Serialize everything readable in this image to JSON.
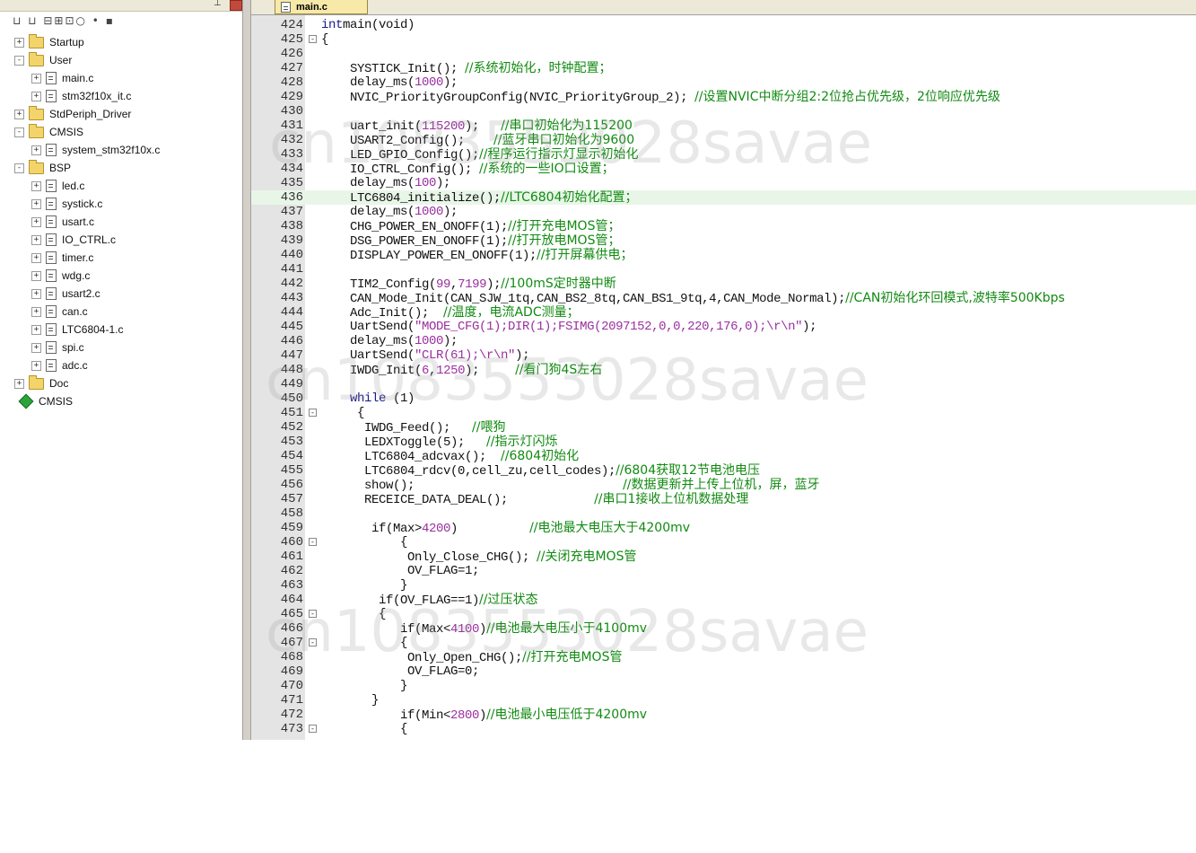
{
  "tab": {
    "label": "main.c"
  },
  "sidebar": {
    "items": [
      {
        "label": "Startup",
        "type": "folder",
        "expander": "+"
      },
      {
        "label": "User",
        "type": "folder",
        "expander": "-"
      },
      {
        "label": "main.c",
        "type": "file",
        "expander": "+"
      },
      {
        "label": "stm32f10x_it.c",
        "type": "file",
        "expander": "+"
      },
      {
        "label": "StdPeriph_Driver",
        "type": "folder",
        "expander": "+"
      },
      {
        "label": "CMSIS",
        "type": "folder",
        "expander": "-"
      },
      {
        "label": "system_stm32f10x.c",
        "type": "file",
        "expander": "+"
      },
      {
        "label": "BSP",
        "type": "folder",
        "expander": "-"
      },
      {
        "label": "led.c",
        "type": "file",
        "expander": "+"
      },
      {
        "label": "systick.c",
        "type": "file",
        "expander": "+"
      },
      {
        "label": "usart.c",
        "type": "file",
        "expander": "+"
      },
      {
        "label": "IO_CTRL.c",
        "type": "file",
        "expander": "+"
      },
      {
        "label": "timer.c",
        "type": "file",
        "expander": "+"
      },
      {
        "label": "wdg.c",
        "type": "file",
        "expander": "+"
      },
      {
        "label": "usart2.c",
        "type": "file",
        "expander": "+"
      },
      {
        "label": "can.c",
        "type": "file",
        "expander": "+"
      },
      {
        "label": "LTC6804-1.c",
        "type": "file",
        "expander": "+"
      },
      {
        "label": "spi.c",
        "type": "file",
        "expander": "+"
      },
      {
        "label": "adc.c",
        "type": "file",
        "expander": "+"
      },
      {
        "label": "Doc",
        "type": "folder",
        "expander": "+"
      },
      {
        "label": "CMSIS",
        "type": "component",
        "expander": ""
      }
    ]
  },
  "code": {
    "lines": [
      {
        "n": "424",
        "fold": "",
        "segs": [
          [
            "kw",
            "int"
          ],
          [
            "",
            "main(void)"
          ]
        ]
      },
      {
        "n": "425",
        "fold": "-",
        "segs": [
          [
            "",
            "{"
          ]
        ]
      },
      {
        "n": "426",
        "fold": "",
        "segs": []
      },
      {
        "n": "427",
        "fold": "",
        "segs": [
          [
            "",
            "    SYSTICK_Init(); "
          ],
          [
            "cm",
            "//系统初始化，时钟配置；"
          ]
        ]
      },
      {
        "n": "428",
        "fold": "",
        "segs": [
          [
            "",
            "    delay_ms("
          ],
          [
            "num",
            "1000"
          ],
          [
            "",
            ");"
          ]
        ]
      },
      {
        "n": "429",
        "fold": "",
        "segs": [
          [
            "",
            "    NVIC_PriorityGroupConfig(NVIC_PriorityGroup_2); "
          ],
          [
            "cm",
            "//设置NVIC中断分组2:2位抢占优先级，2位响应优先级"
          ]
        ]
      },
      {
        "n": "430",
        "fold": "",
        "segs": []
      },
      {
        "n": "431",
        "fold": "",
        "segs": [
          [
            "",
            "    uart_init("
          ],
          [
            "num",
            "115200"
          ],
          [
            "",
            ");   "
          ],
          [
            "cm",
            "//串口初始化为115200"
          ]
        ]
      },
      {
        "n": "432",
        "fold": "",
        "segs": [
          [
            "",
            "    USART2_Config();    "
          ],
          [
            "cm",
            "//蓝牙串口初始化为9600"
          ]
        ]
      },
      {
        "n": "433",
        "fold": "",
        "segs": [
          [
            "",
            "    LED_GPIO_Config();"
          ],
          [
            "cm",
            "//程序运行指示灯显示初始化"
          ]
        ]
      },
      {
        "n": "434",
        "fold": "",
        "segs": [
          [
            "",
            "    IO_CTRL_Config(); "
          ],
          [
            "cm",
            "//系统的一些IO口设置；"
          ]
        ]
      },
      {
        "n": "435",
        "fold": "",
        "segs": [
          [
            "",
            "    delay_ms("
          ],
          [
            "num",
            "100"
          ],
          [
            "",
            ");"
          ]
        ]
      },
      {
        "n": "436",
        "fold": "",
        "hl": true,
        "segs": [
          [
            "",
            "    LTC6804_initialize();"
          ],
          [
            "cm",
            "//LTC6804初始化配置；"
          ]
        ]
      },
      {
        "n": "437",
        "fold": "",
        "segs": [
          [
            "",
            "    delay_ms("
          ],
          [
            "num",
            "1000"
          ],
          [
            "",
            ");"
          ]
        ]
      },
      {
        "n": "438",
        "fold": "",
        "segs": [
          [
            "",
            "    CHG_POWER_EN_ONOFF(1);"
          ],
          [
            "cm",
            "//打开充电MOS管；"
          ]
        ]
      },
      {
        "n": "439",
        "fold": "",
        "segs": [
          [
            "",
            "    DSG_POWER_EN_ONOFF(1);"
          ],
          [
            "cm",
            "//打开放电MOS管；"
          ]
        ]
      },
      {
        "n": "440",
        "fold": "",
        "segs": [
          [
            "",
            "    DISPLAY_POWER_EN_ONOFF(1);"
          ],
          [
            "cm",
            "//打开屏幕供电；"
          ]
        ]
      },
      {
        "n": "441",
        "fold": "",
        "segs": []
      },
      {
        "n": "442",
        "fold": "",
        "segs": [
          [
            "",
            "    TIM2_Config("
          ],
          [
            "num",
            "99"
          ],
          [
            "",
            ","
          ],
          [
            "num",
            "7199"
          ],
          [
            "",
            ");"
          ],
          [
            "cm",
            "//100mS定时器中断"
          ]
        ]
      },
      {
        "n": "443",
        "fold": "",
        "segs": [
          [
            "",
            "    CAN_Mode_Init(CAN_SJW_1tq,CAN_BS2_8tq,CAN_BS1_9tq,4,CAN_Mode_Normal);"
          ],
          [
            "cm",
            "//CAN初始化环回模式,波特率500Kbps"
          ]
        ]
      },
      {
        "n": "444",
        "fold": "",
        "segs": [
          [
            "",
            "    Adc_Init();  "
          ],
          [
            "cm",
            "//温度，电流ADC测量；"
          ]
        ]
      },
      {
        "n": "445",
        "fold": "",
        "segs": [
          [
            "",
            "    UartSend("
          ],
          [
            "str",
            "\"MODE_CFG(1);DIR(1);FSIMG(2097152,0,0,220,176,0);\\r\\n\""
          ],
          [
            "",
            ");"
          ]
        ]
      },
      {
        "n": "446",
        "fold": "",
        "segs": [
          [
            "",
            "    delay_ms("
          ],
          [
            "num",
            "1000"
          ],
          [
            "",
            ");"
          ]
        ]
      },
      {
        "n": "447",
        "fold": "",
        "segs": [
          [
            "",
            "    UartSend("
          ],
          [
            "str",
            "\"CLR(61);\\r\\n\""
          ],
          [
            "",
            ");"
          ]
        ]
      },
      {
        "n": "448",
        "fold": "",
        "segs": [
          [
            "",
            "    IWDG_Init("
          ],
          [
            "num",
            "6"
          ],
          [
            "",
            ","
          ],
          [
            "num",
            "1250"
          ],
          [
            "",
            ");     "
          ],
          [
            "cm",
            "//看门狗4S左右"
          ]
        ]
      },
      {
        "n": "449",
        "fold": "",
        "segs": []
      },
      {
        "n": "450",
        "fold": "",
        "segs": [
          [
            "",
            "    "
          ],
          [
            "kw",
            "while"
          ],
          [
            "",
            " (1)"
          ]
        ]
      },
      {
        "n": "451",
        "fold": "-",
        "segs": [
          [
            "",
            "     {"
          ]
        ]
      },
      {
        "n": "452",
        "fold": "",
        "segs": [
          [
            "",
            "      IWDG_Feed();   "
          ],
          [
            "cm",
            "//喂狗"
          ]
        ]
      },
      {
        "n": "453",
        "fold": "",
        "segs": [
          [
            "",
            "      LEDXToggle(5);   "
          ],
          [
            "cm",
            "//指示灯闪烁"
          ]
        ]
      },
      {
        "n": "454",
        "fold": "",
        "segs": [
          [
            "",
            "      LTC6804_adcvax();  "
          ],
          [
            "cm",
            "//6804初始化"
          ]
        ]
      },
      {
        "n": "455",
        "fold": "",
        "segs": [
          [
            "",
            "      LTC6804_rdcv(0,cell_zu,cell_codes);"
          ],
          [
            "cm",
            "//6804获取12节电池电压"
          ]
        ]
      },
      {
        "n": "456",
        "fold": "",
        "segs": [
          [
            "",
            "      show();                             "
          ],
          [
            "cm",
            "//数据更新并上传上位机，屏，蓝牙"
          ]
        ]
      },
      {
        "n": "457",
        "fold": "",
        "segs": [
          [
            "",
            "      RECEICE_DATA_DEAL();            "
          ],
          [
            "cm",
            "//串口1接收上位机数据处理"
          ]
        ]
      },
      {
        "n": "458",
        "fold": "",
        "segs": []
      },
      {
        "n": "459",
        "fold": "",
        "segs": [
          [
            "",
            "       if(Max>"
          ],
          [
            "num",
            "4200"
          ],
          [
            "",
            ")          "
          ],
          [
            "cm",
            "//电池最大电压大于4200mv"
          ]
        ]
      },
      {
        "n": "460",
        "fold": "-",
        "segs": [
          [
            "",
            "           {"
          ]
        ]
      },
      {
        "n": "461",
        "fold": "",
        "segs": [
          [
            "",
            "            Only_Close_CHG(); "
          ],
          [
            "cm",
            "//关闭充电MOS管"
          ]
        ]
      },
      {
        "n": "462",
        "fold": "",
        "segs": [
          [
            "",
            "            OV_FLAG=1;"
          ]
        ]
      },
      {
        "n": "463",
        "fold": "",
        "segs": [
          [
            "",
            "           }"
          ]
        ]
      },
      {
        "n": "464",
        "fold": "",
        "segs": [
          [
            "",
            "        if(OV_FLAG==1)"
          ],
          [
            "cm",
            "//过压状态"
          ]
        ]
      },
      {
        "n": "465",
        "fold": "-",
        "segs": [
          [
            "",
            "        {"
          ]
        ]
      },
      {
        "n": "466",
        "fold": "",
        "segs": [
          [
            "",
            "           if(Max<"
          ],
          [
            "num",
            "4100"
          ],
          [
            "",
            ")"
          ],
          [
            "cm",
            "//电池最大电压小于4100mv"
          ]
        ]
      },
      {
        "n": "467",
        "fold": "-",
        "segs": [
          [
            "",
            "           {"
          ]
        ]
      },
      {
        "n": "468",
        "fold": "",
        "segs": [
          [
            "",
            "            Only_Open_CHG();"
          ],
          [
            "cm",
            "//打开充电MOS管"
          ]
        ]
      },
      {
        "n": "469",
        "fold": "",
        "segs": [
          [
            "",
            "            OV_FLAG=0;"
          ]
        ]
      },
      {
        "n": "470",
        "fold": "",
        "segs": [
          [
            "",
            "           }"
          ]
        ]
      },
      {
        "n": "471",
        "fold": "",
        "segs": [
          [
            "",
            "       }"
          ]
        ]
      },
      {
        "n": "472",
        "fold": "",
        "segs": [
          [
            "",
            "           if(Min<"
          ],
          [
            "num",
            "2800"
          ],
          [
            "",
            ")"
          ],
          [
            "cm",
            "//电池最小电压低于4200mv"
          ]
        ]
      },
      {
        "n": "473",
        "fold": "-",
        "segs": [
          [
            "",
            "           {"
          ]
        ]
      }
    ]
  },
  "watermarks": [
    "cn1083553028savae",
    "cn1083553028savae",
    "cn1083553028savae"
  ],
  "colors": {
    "keyword": "#1a1a8c",
    "number": "#9a2fa0",
    "comment": "#118a11",
    "highlight_line": "#e8f6e8",
    "gutter": "#e4e4e4"
  }
}
